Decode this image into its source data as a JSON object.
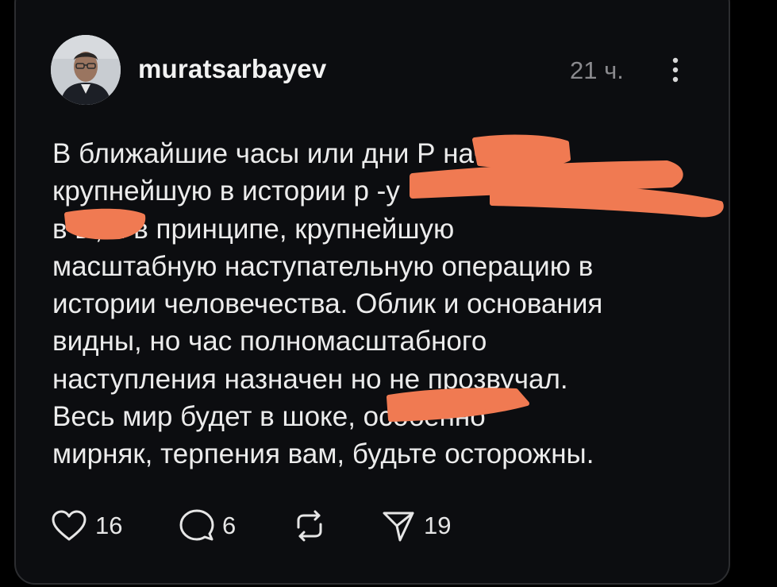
{
  "post": {
    "username": "muratsarbayev",
    "time": "21 ч.",
    "lines": [
      "В ближайшие часы или дни Р        начнёт",
      "крупнейшую в истории р          -у",
      "в      ы, и в принципе, крупнейшую",
      "масштабную наступательную операцию в",
      "истории человечества. Облик и основания",
      "видны, но час полномасштабного",
      "наступления назначен но не прозвучал.",
      "Весь мир будет в шоке,                  особенно",
      "мирняк, терпения вам, будьте осторожны."
    ]
  },
  "actions": {
    "likes": "16",
    "comments": "6",
    "shares": "19"
  },
  "icons": [
    "avatar",
    "more-icon",
    "heart-icon",
    "comment-icon",
    "repost-icon",
    "share-icon"
  ],
  "colors": {
    "background": "#000000",
    "card": "#0c0d10",
    "text": "#ececec",
    "muted": "#8a8a8e",
    "redaction": "#f07a52"
  }
}
